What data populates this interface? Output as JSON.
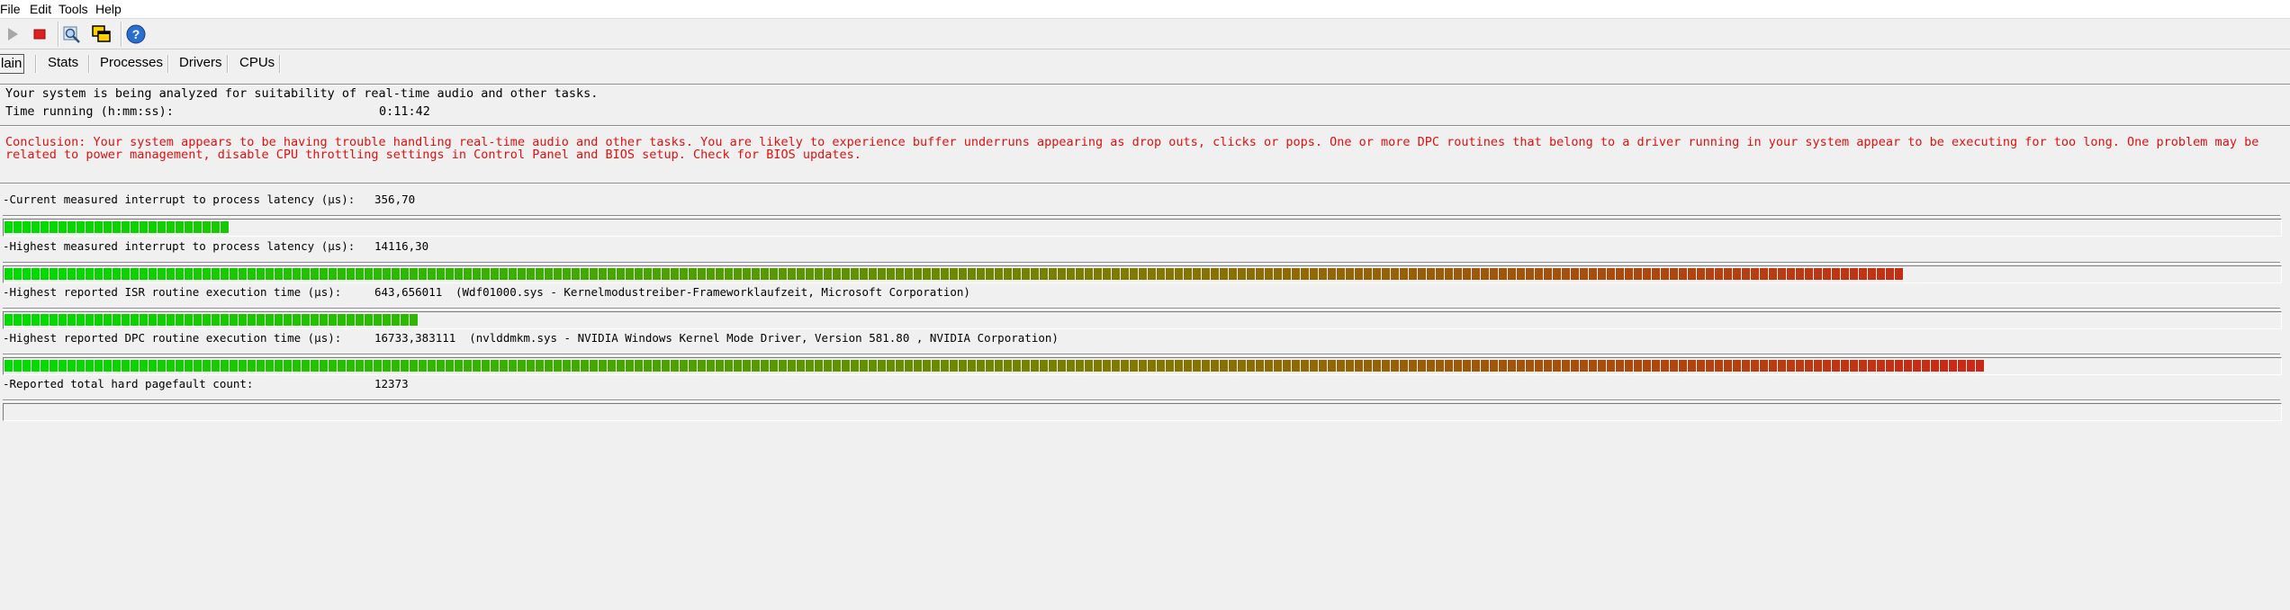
{
  "menu": [
    "File",
    "Edit",
    "Tools",
    "Help"
  ],
  "toolbar": {
    "icons": [
      "play-icon",
      "stop-icon",
      "search-icon",
      "windows-icon",
      "help-icon"
    ]
  },
  "tabs": [
    "Main",
    "Stats",
    "Processes",
    "Drivers",
    "CPUs"
  ],
  "tab_visible_text": [
    "lain",
    "Stats",
    "Processes",
    "Drivers",
    "CPUs"
  ],
  "status": {
    "line1": "Your system is being analyzed for suitability of real-time audio and other tasks.",
    "time_label": "Time running (h:mm:ss):",
    "time_value": "0:11:42"
  },
  "conclusion": {
    "line1": "Conclusion: Your system appears to be having trouble handling real-time audio and other tasks. You are likely to experience buffer underruns appearing as drop outs, clicks or pops. One or more DPC routines that belong to a driver running in your system appear to be executing for too long. One problem may be",
    "line2": "related to power management, disable CPU throttling settings in Control Panel and BIOS setup. Check for BIOS updates."
  },
  "metrics": [
    {
      "label": "-Current measured interrupt to process latency (µs):",
      "value": "356,70",
      "detail": "",
      "fill": 0.102
    },
    {
      "label": "-Highest measured interrupt to process latency (µs):",
      "value": "14116,30",
      "detail": "",
      "fill": 0.839
    },
    {
      "label": "-Highest reported ISR routine execution time (µs):",
      "value": "643,656011",
      "detail": "(Wdf01000.sys - Kernelmodustreiber-Frameworklaufzeit, Microsoft Corporation)",
      "fill": 0.184
    },
    {
      "label": "-Highest reported DPC routine execution time (µs):",
      "value": "16733,383111",
      "detail": "(nvlddmkm.sys - NVIDIA Windows Kernel Mode Driver, Version 581.80 , NVIDIA Corporation)",
      "fill": 0.872
    },
    {
      "label": "-Reported total hard pagefault count:",
      "value": "12373",
      "detail": "",
      "fill": 0
    }
  ]
}
